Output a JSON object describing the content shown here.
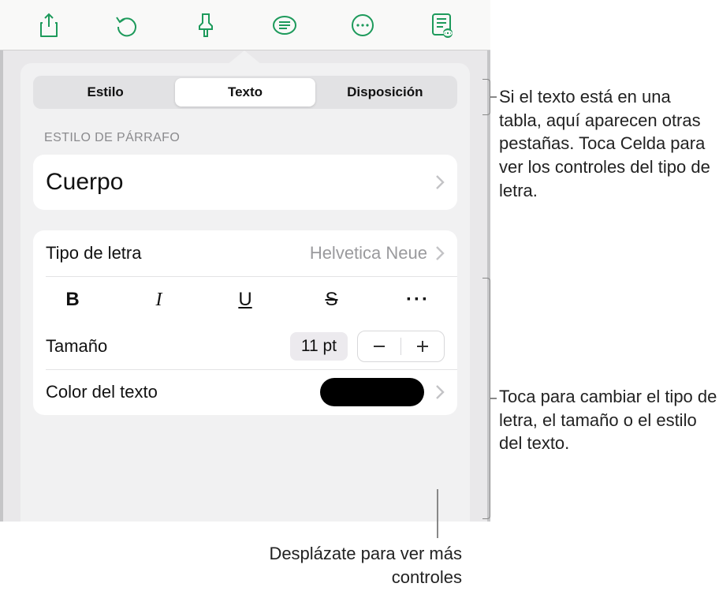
{
  "toolbar": {
    "icons": [
      "share-icon",
      "undo-icon",
      "format-brush-icon",
      "paragraph-icon",
      "more-icon",
      "presenter-icon"
    ]
  },
  "segmented": {
    "tabs": [
      {
        "label": "Estilo",
        "selected": false
      },
      {
        "label": "Texto",
        "selected": true
      },
      {
        "label": "Disposición",
        "selected": false
      }
    ]
  },
  "paragraph_style": {
    "section_label": "ESTILO DE PÁRRAFO",
    "current": "Cuerpo"
  },
  "font": {
    "label": "Tipo de letra",
    "value": "Helvetica Neue"
  },
  "text_styles": {
    "bold": "B",
    "italic": "I",
    "underline": "U",
    "strike": "S",
    "more": "···"
  },
  "size": {
    "label": "Tamaño",
    "value": "11 pt"
  },
  "text_color": {
    "label": "Color del texto",
    "swatch": "#000000"
  },
  "callouts": {
    "tabs_note": "Si el texto está en una tabla, aquí aparecen otras pestañas. Toca Celda para ver los controles del tipo de letra.",
    "font_note": "Toca para cambiar el tipo de letra, el tamaño o el estilo del texto.",
    "scroll_note": "Desplázate para ver más controles"
  }
}
